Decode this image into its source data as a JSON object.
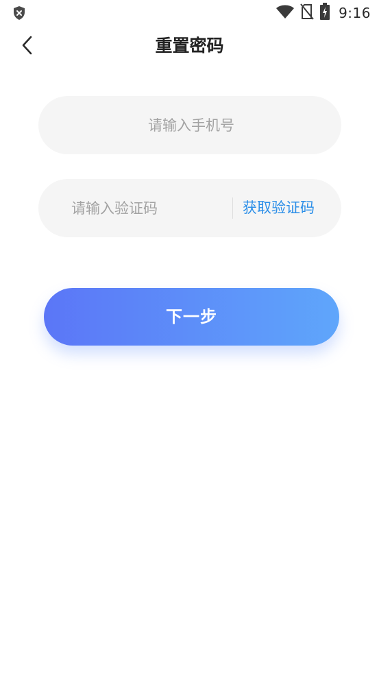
{
  "status_bar": {
    "time": "9:16",
    "icons": [
      "shield-alert-icon",
      "wifi-icon",
      "no-sim-icon",
      "battery-charging-icon"
    ]
  },
  "header": {
    "back_icon": "chevron-left-icon",
    "title": "重置密码"
  },
  "form": {
    "phone": {
      "value": "",
      "placeholder": "请输入手机号"
    },
    "code": {
      "value": "",
      "placeholder": "请输入验证码"
    },
    "get_code_label": "获取验证码"
  },
  "actions": {
    "next_label": "下一步"
  },
  "colors": {
    "accent": "#2b8ee8",
    "button_gradient_start": "#5b76f7",
    "button_gradient_end": "#5fa6fb",
    "input_background": "#f5f5f5",
    "placeholder": "#a3a3a3"
  }
}
